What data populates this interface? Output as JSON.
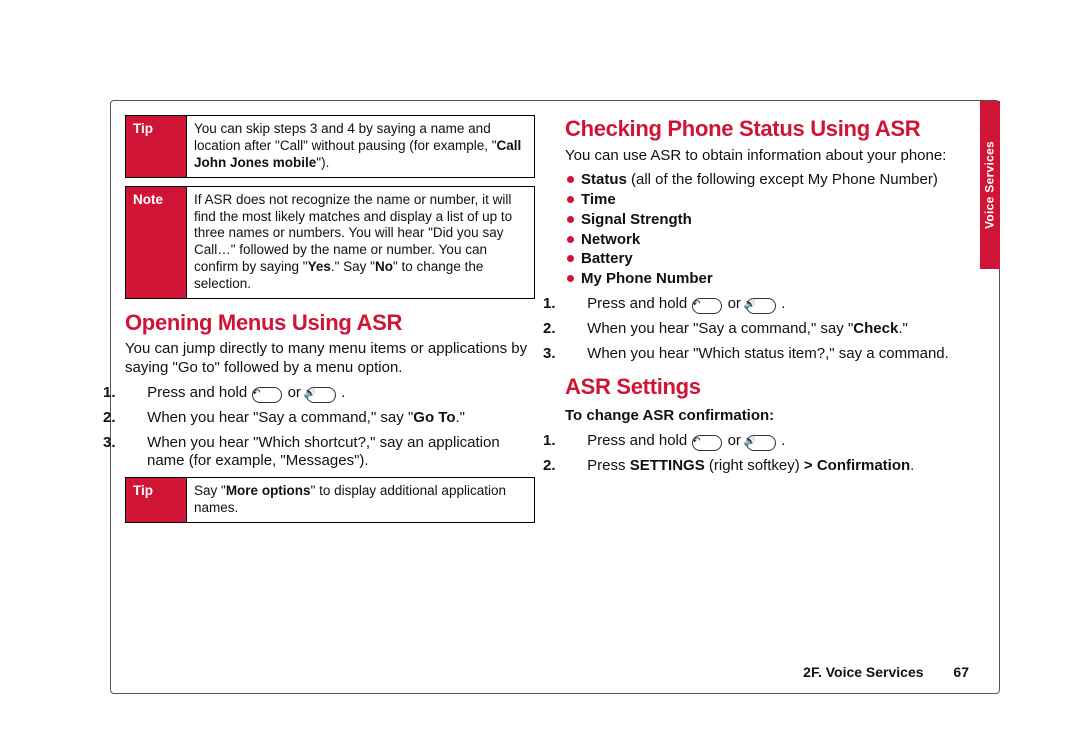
{
  "left": {
    "tip1_label": "Tip",
    "tip1_text_a": "You can skip steps 3 and 4 by saying a name and location after \"Call\" without pausing (for example, \"",
    "tip1_text_b": "Call John Jones mobile",
    "tip1_text_c": "\").",
    "note_label": "Note",
    "note_a": "If ASR does not recognize the name or number, it will find the most likely matches and display a list of up to three names or numbers. You will hear \"Did you say Call…\" followed by the name or number. You can confirm by saying \"",
    "note_b": "Yes",
    "note_c": ".\" Say \"",
    "note_d": "No",
    "note_e": "\" to change the selection.",
    "h_open": "Opening Menus Using ASR",
    "open_intro": "You can jump directly to many menu items or applications by saying \"Go to\" followed by a menu option.",
    "step1_a": "Press and hold ",
    "step1_or": " or ",
    "step1_b": " .",
    "step2_a": "When you hear \"Say a command,\" say \"",
    "step2_b": "Go To",
    "step2_c": ".\"",
    "step3": "When you hear \"Which shortcut?,\" say an application name (for example, \"Messages\").",
    "tip2_label": "Tip",
    "tip2_a": "Say \"",
    "tip2_b": "More options",
    "tip2_c": "\" to display additional application names."
  },
  "right": {
    "h_status": "Checking Phone Status Using ASR",
    "status_intro": "You can use ASR to obtain information about your phone:",
    "bul_status_a": "Status",
    "bul_status_b": " (all of the following except My Phone Number)",
    "bul_time": "Time",
    "bul_signal": "Signal Strength",
    "bul_network": "Network",
    "bul_battery": "Battery",
    "bul_phone": "My Phone Number",
    "s1_a": "Press and hold ",
    "s1_or": " or ",
    "s1_b": " .",
    "s2_a": "When you hear \"Say a command,\" say \"",
    "s2_b": "Check",
    "s2_c": ".\"",
    "s3": "When you hear \"Which status item?,\" say a command.",
    "h_settings": "ASR Settings",
    "settings_sub": "To change ASR confirmation:",
    "a1_a": "Press and hold ",
    "a1_or": " or ",
    "a1_b": " .",
    "a2_a": "Press ",
    "a2_b": "SETTINGS",
    "a2_c": " (right softkey) ",
    "a2_d": "> Confirmation",
    "a2_e": "."
  },
  "footer_section": "2F. Voice Services",
  "footer_page": "67",
  "side_tab": "Voice Services",
  "icons": {
    "key_call": "↶",
    "key_speaker": "🔊"
  }
}
